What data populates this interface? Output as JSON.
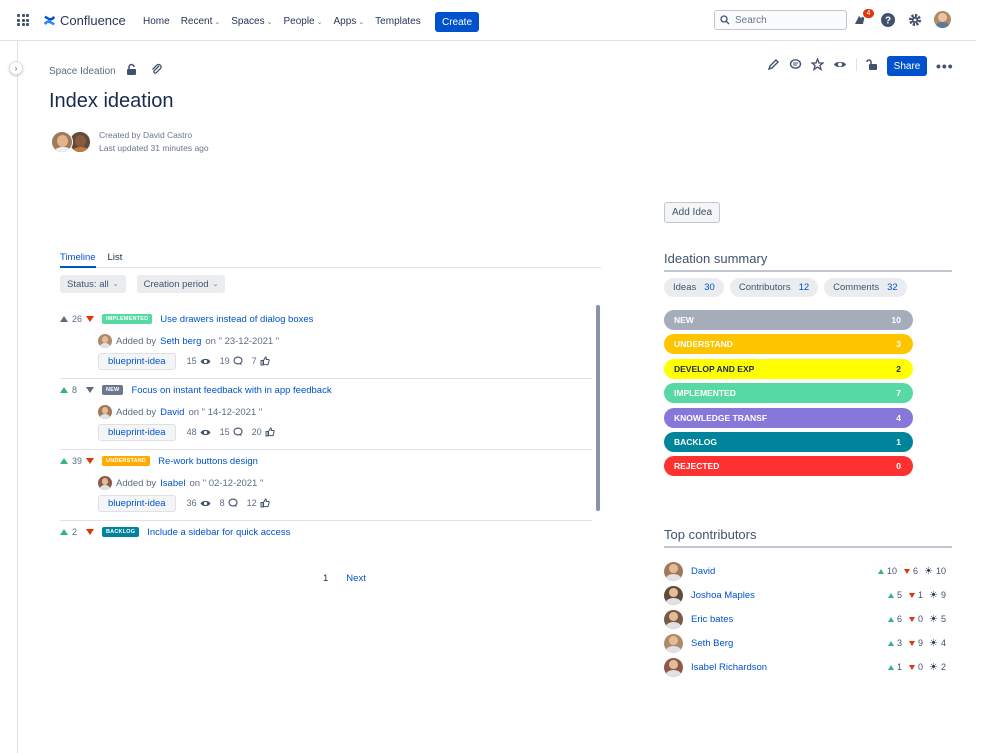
{
  "app": {
    "name": "Confluence",
    "nav": [
      {
        "label": "Home",
        "has_menu": false
      },
      {
        "label": "Recent",
        "has_menu": true
      },
      {
        "label": "Spaces",
        "has_menu": true
      },
      {
        "label": "People",
        "has_menu": true
      },
      {
        "label": "Apps",
        "has_menu": true
      },
      {
        "label": "Templates",
        "has_menu": false
      }
    ],
    "create_label": "Create",
    "search_placeholder": "Search",
    "notification_count": "4",
    "colors": {
      "brand": "#0052cc",
      "badge": "#de350b"
    }
  },
  "page": {
    "breadcrumb": "Space Ideation",
    "title": "Index ideation",
    "created_by": "Created by David Castro",
    "last_updated": "Last updated 31 minutes ago",
    "share_label": "Share",
    "more_label": "•••"
  },
  "ideation": {
    "add_idea_label": "Add Idea",
    "tabs": [
      {
        "label": "Timeline",
        "active": true
      },
      {
        "label": "List",
        "active": false
      }
    ],
    "filters": [
      "Status: all",
      "Creation period"
    ],
    "ideas": [
      {
        "up": "26",
        "up_color": "grey",
        "down_color": "red",
        "status": "IMPLEMENTED",
        "status_color": "#57d9a3",
        "title": "Use drawers instead of dialog boxes",
        "added_prefix": "Added by",
        "author": "Seth berg",
        "date": "on \" 23-12-2021 \"",
        "tag": "blueprint-idea",
        "views": "15",
        "comments": "19",
        "likes": "7",
        "avatar_color": "#b08968"
      },
      {
        "up": "8",
        "up_color": "green",
        "down_color": "grey",
        "status": "NEW",
        "status_color": "#6b778c",
        "title": "Focus on instant feedback with in app feedback",
        "added_prefix": "Added by",
        "author": "David",
        "date": "on \" 14-12-2021 \"",
        "tag": "blueprint-idea",
        "views": "48",
        "comments": "15",
        "likes": "20",
        "avatar_color": "#a0785a"
      },
      {
        "up": "39",
        "up_color": "green",
        "down_color": "red",
        "status": "UNDERSTAND",
        "status_color": "#ffab00",
        "title": "Re-work buttons design",
        "added_prefix": "Added by",
        "author": "Isabel",
        "date": "on \" 02-12-2021 \"",
        "tag": "blueprint-idea",
        "views": "36",
        "comments": "8",
        "likes": "12",
        "avatar_color": "#8d5a4a"
      },
      {
        "up": "2",
        "up_color": "green",
        "down_color": "red",
        "status": "BACKLOG",
        "status_color": "#00849c",
        "title": "Include a sidebar for quick access"
      }
    ],
    "pagination": {
      "current": "1",
      "next": "Next"
    }
  },
  "summary": {
    "title": "Ideation summary",
    "pills": [
      {
        "label": "Ideas",
        "value": "30"
      },
      {
        "label": "Contributors",
        "value": "12"
      },
      {
        "label": "Comments",
        "value": "32"
      }
    ],
    "statuses": [
      {
        "label": "NEW",
        "count": "10",
        "bg": "#a5adba",
        "fg": "#ffffff"
      },
      {
        "label": "UNDERSTAND",
        "count": "3",
        "bg": "#ffc400",
        "fg": "#ffffff"
      },
      {
        "label": "DEVELOP AND EXP",
        "count": "2",
        "bg": "#ffff00",
        "fg": "#172b4d"
      },
      {
        "label": "IMPLEMENTED",
        "count": "7",
        "bg": "#57d9a3",
        "fg": "#ffffff"
      },
      {
        "label": "KNOWLEDGE TRANSF",
        "count": "4",
        "bg": "#8777d9",
        "fg": "#ffffff"
      },
      {
        "label": "BACKLOG",
        "count": "1",
        "bg": "#00849c",
        "fg": "#ffffff"
      },
      {
        "label": "REJECTED",
        "count": "0",
        "bg": "#ff3030",
        "fg": "#ffffff"
      }
    ]
  },
  "contributors": {
    "title": "Top contributors",
    "items": [
      {
        "name": "David",
        "up": "10",
        "down": "6",
        "ideas": "10",
        "avatar_color": "#a0785a"
      },
      {
        "name": "Joshoa Maples",
        "up": "5",
        "down": "1",
        "ideas": "9",
        "avatar_color": "#5e4b3c"
      },
      {
        "name": "Eric bates",
        "up": "6",
        "down": "0",
        "ideas": "5",
        "avatar_color": "#7a5a44"
      },
      {
        "name": "Seth Berg",
        "up": "3",
        "down": "9",
        "ideas": "4",
        "avatar_color": "#b08968"
      },
      {
        "name": "Isabel Richardson",
        "up": "1",
        "down": "0",
        "ideas": "2",
        "avatar_color": "#8d5a4a"
      }
    ]
  }
}
